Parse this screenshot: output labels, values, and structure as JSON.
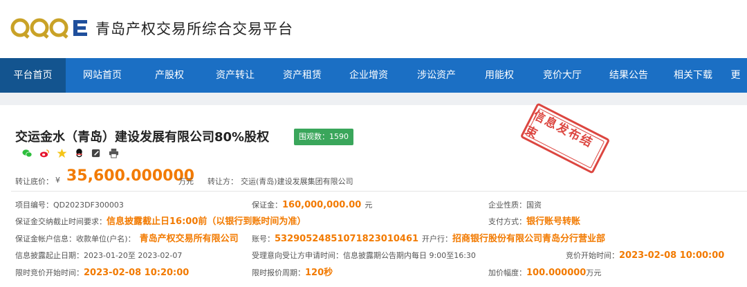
{
  "header": {
    "logo_alt": "QPPE",
    "site_title": "青岛产权交易所综合交易平台"
  },
  "nav": {
    "items": [
      {
        "label": "平台首页",
        "width": 95,
        "active": true
      },
      {
        "label": "网站首页",
        "width": 106
      },
      {
        "label": "产股权",
        "width": 88
      },
      {
        "label": "资产转让",
        "width": 102
      },
      {
        "label": "资产租赁",
        "width": 92
      },
      {
        "label": "企业增资",
        "width": 100
      },
      {
        "label": "涉讼资产",
        "width": 96
      },
      {
        "label": "用能权",
        "width": 86
      },
      {
        "label": "竞价大厅",
        "width": 96
      },
      {
        "label": "结果公告",
        "width": 96
      },
      {
        "label": "相关下载",
        "width": 90
      },
      {
        "label": "更",
        "width": 33
      }
    ]
  },
  "project": {
    "title": "交运金水（青岛）建设发展有限公司80%股权",
    "views_label": "围观数：1590",
    "stamp": "信息发布结束"
  },
  "price": {
    "label": "转让底价：",
    "currency": "¥",
    "value": "35,600.000000",
    "unit": "万元",
    "seller_label": "转让方：",
    "seller": "交运(青岛)建设发展集团有限公司"
  },
  "details": {
    "project_no_label": "项目编号：",
    "project_no": "QD2023DF300003",
    "deposit_label": "保证金：",
    "deposit": "160,000,000.00",
    "deposit_unit": "元",
    "nature_label": "企业性质：",
    "nature": "国资",
    "deposit_deadline_label": "保证金交纳截止时间要求：",
    "deposit_deadline": "信息披露截止日16:00前（以银行到账时间为准）",
    "pay_label": "支付方式：",
    "pay_method": "银行账号转账",
    "account_info_label": "保证金帐户信息：",
    "payee_label": "收款单位(户名)：",
    "payee": "青岛产权交易所有限公司",
    "account_label": "账号：",
    "account": "532905248510718230104​61",
    "bank_label": "开户行：",
    "bank": "招商银行股份有限公司青岛分行营业部",
    "disclose_label": "信息披露起止日期：",
    "disclose_period": "2023-01-20至 2023-02-07",
    "intent_label": "受理意向受让方申请时间：",
    "intent_period": "信息披露期公告期内每日 9:00至16:30",
    "bid_start_label": "竞价开始时间：",
    "bid_start": "2023-02-08 10:00:00",
    "limited_start_label": "限时竞价开始时间：",
    "limited_start": "2023-02-08 10:20:00",
    "limited_cycle_label": "限时报价周期：",
    "limited_cycle": "120秒",
    "increment_label": "加价幅度：",
    "increment": "100.000000",
    "increment_unit": "万元"
  },
  "colors": {
    "nav_bg": "#1b6fc4",
    "nav_active": "#13548f",
    "accent_orange": "#f27a00",
    "views_green": "#3aa65b",
    "stamp_red": "#d9322c"
  }
}
